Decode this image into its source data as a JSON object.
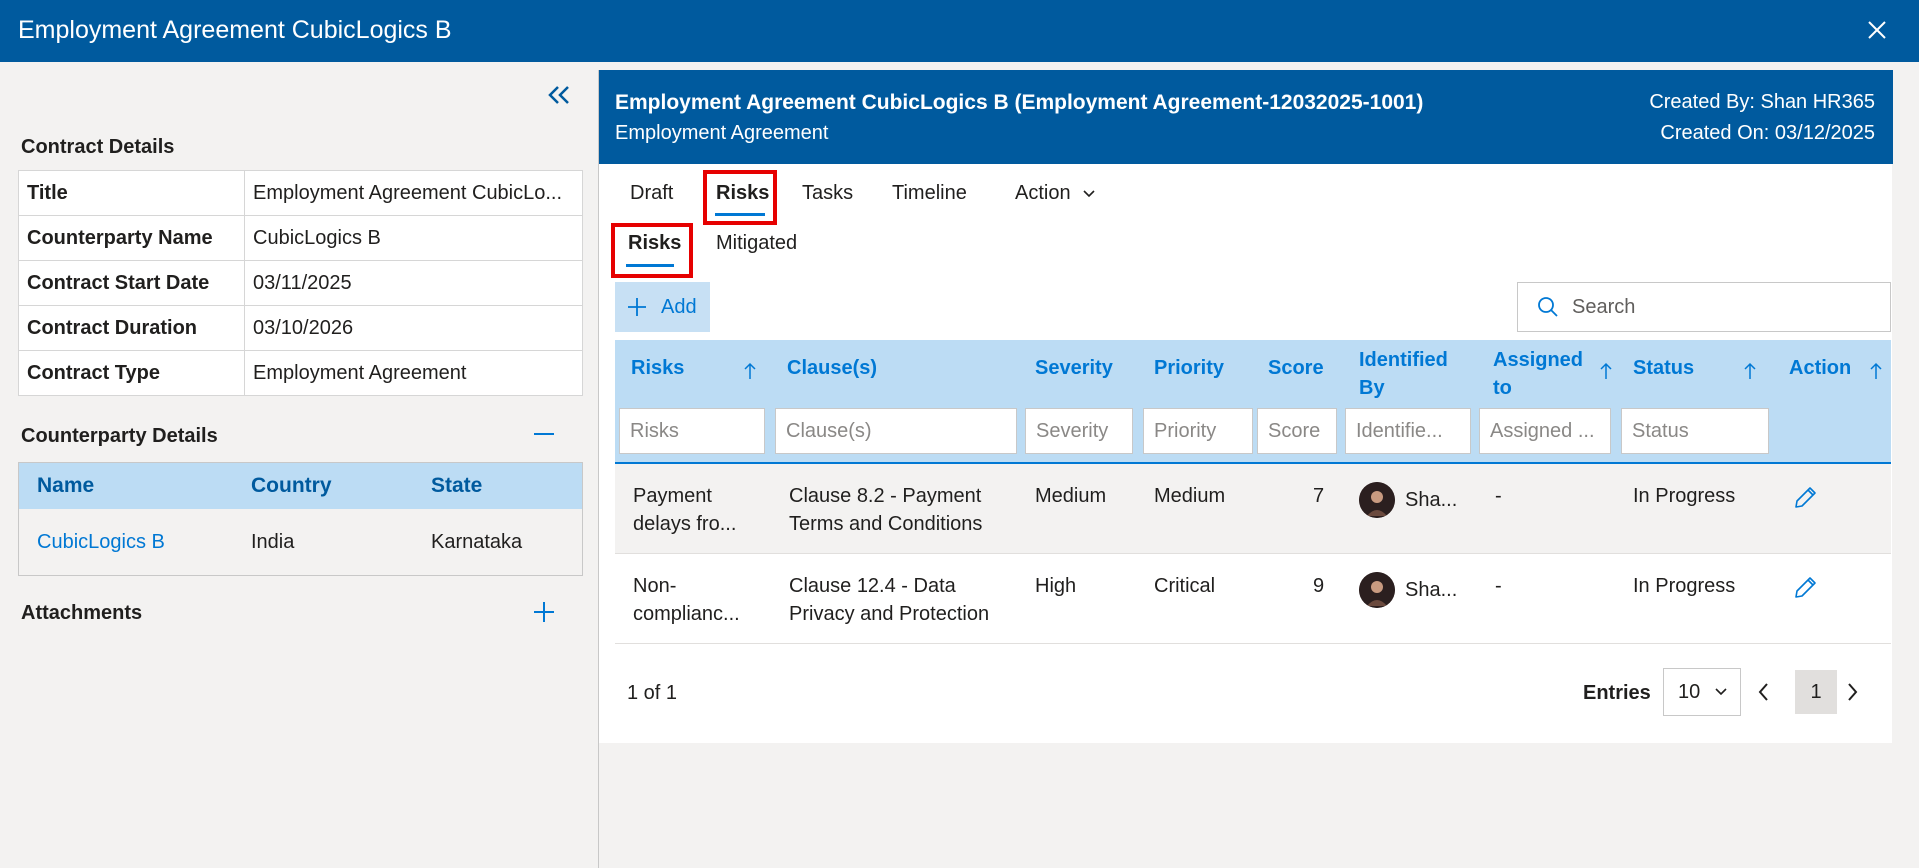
{
  "window": {
    "title": "Employment Agreement CubicLogics B"
  },
  "left": {
    "contract_details_title": "Contract Details",
    "details": [
      {
        "key": "Title",
        "value": "Employment Agreement CubicLo..."
      },
      {
        "key": "Counterparty Name",
        "value": "CubicLogics B"
      },
      {
        "key": "Contract Start Date",
        "value": "03/11/2025"
      },
      {
        "key": "Contract Duration",
        "value": "03/10/2026"
      },
      {
        "key": "Contract Type",
        "value": "Employment Agreement"
      }
    ],
    "counterparty_title": "Counterparty Details",
    "counterparty_headers": {
      "name": "Name",
      "country": "Country",
      "state": "State"
    },
    "counterparty_rows": [
      {
        "name": "CubicLogics B",
        "country": "India",
        "state": "Karnataka"
      }
    ],
    "attachments_title": "Attachments"
  },
  "header": {
    "title": "Employment Agreement CubicLogics B (Employment Agreement-12032025-1001)",
    "subtitle": "Employment Agreement",
    "created_by": "Created By: Shan HR365",
    "created_on": "Created On: 03/12/2025"
  },
  "tabs": {
    "draft": "Draft",
    "risks": "Risks",
    "tasks": "Tasks",
    "timeline": "Timeline",
    "action": "Action"
  },
  "subtabs": {
    "risks": "Risks",
    "mitigated": "Mitigated"
  },
  "toolbar": {
    "add_label": "Add",
    "search_placeholder": "Search"
  },
  "grid": {
    "headers": {
      "risks": "Risks",
      "clauses": "Clause(s)",
      "severity": "Severity",
      "priority": "Priority",
      "score": "Score",
      "identified_by_1": "Identified",
      "identified_by_2": "By",
      "assigned_to_1": "Assigned",
      "assigned_to_2": "to",
      "status": "Status",
      "action": "Action"
    },
    "filters": {
      "risks": "Risks",
      "clauses": "Clause(s)",
      "severity": "Severity",
      "priority": "Priority",
      "score": "Score",
      "identified_by": "Identifie...",
      "assigned_to": "Assigned ...",
      "status": "Status"
    },
    "rows": [
      {
        "risk_1": "Payment",
        "risk_2": "delays fro...",
        "clause_1": "Clause 8.2 - Payment",
        "clause_2": "Terms and Conditions",
        "severity": "Medium",
        "priority": "Medium",
        "score": "7",
        "identified_by": "Sha...",
        "assigned_to": "-",
        "status": "In Progress"
      },
      {
        "risk_1": "Non-",
        "risk_2": "complianc...",
        "clause_1": "Clause 12.4 - Data",
        "clause_2": "Privacy and Protection",
        "severity": "High",
        "priority": "Critical",
        "score": "9",
        "identified_by": "Sha...",
        "assigned_to": "-",
        "status": "In Progress"
      }
    ]
  },
  "pager": {
    "count": "1 of 1",
    "entries_label": "Entries",
    "entries_value": "10",
    "page": "1"
  },
  "colors": {
    "brand": "#005a9e",
    "accent": "#0078d4",
    "header_fill": "#bcdcf4",
    "highlight_box": "#e60000"
  }
}
